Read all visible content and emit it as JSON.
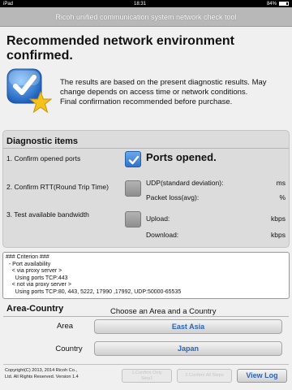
{
  "status_bar": {
    "device": "iPad",
    "time": "18:31",
    "battery_text": "84%",
    "battery_level": 0.84
  },
  "title_bar": {
    "title": "Ricoh unified communication system network check tool"
  },
  "main": {
    "heading": "Recommended network environment confirmed.",
    "badge_icon": "checkmark-star-badge-icon",
    "description": [
      "The results are based on the present diagnostic results. May",
      "change depends on access time or network conditions.",
      "Final confirmation recommended before purchase."
    ]
  },
  "diagnostic": {
    "title": "Diagnostic items",
    "items": [
      {
        "label": "1.  Confirm opened ports",
        "checked": true
      },
      {
        "label": "2.  Confirm RTT(Round Trip Time)",
        "checked": false
      },
      {
        "label": "3.  Test available bandwidth",
        "checked": false
      }
    ],
    "ports_result": "Ports opened.",
    "udp_label": "UDP(standard deviation):",
    "udp_unit": "ms",
    "loss_label": "Packet loss(avg):",
    "loss_unit": "%",
    "upload_label": "Upload:",
    "upload_unit": "kbps",
    "download_label": "Download:",
    "download_unit": "kbps"
  },
  "log": {
    "lines": [
      "### Criterion ###",
      "  - Port availability",
      "    < via proxy server >",
      "      Using ports TCP:443",
      "    < not via proxy server >",
      "      Using ports TCP:80, 443, 5222, 17990 ,17992, UDP:50000-65535"
    ]
  },
  "area": {
    "title": "Area-Country",
    "prompt": "Choose an Area and a Country",
    "area_label": "Area",
    "area_value": "East Asia",
    "country_label": "Country",
    "country_value": "Japan"
  },
  "footer": {
    "copyright_line1": "Copyright(C) 2013, 2014 Ricoh Co.,",
    "copyright_line2": "Ltd. All Rights Reserved. Version 1.4",
    "confirm_only_line1": "1.Confirm Only",
    "confirm_only_line2": "Step1",
    "confirm_all": "2.Confirm All Steps",
    "view_log": "View Log"
  },
  "colors": {
    "accent_blue": "#2b64b8",
    "checkbox_on": "#3a7fd5",
    "title_bar": "#b8b8b8",
    "star": "#f6c21a"
  }
}
